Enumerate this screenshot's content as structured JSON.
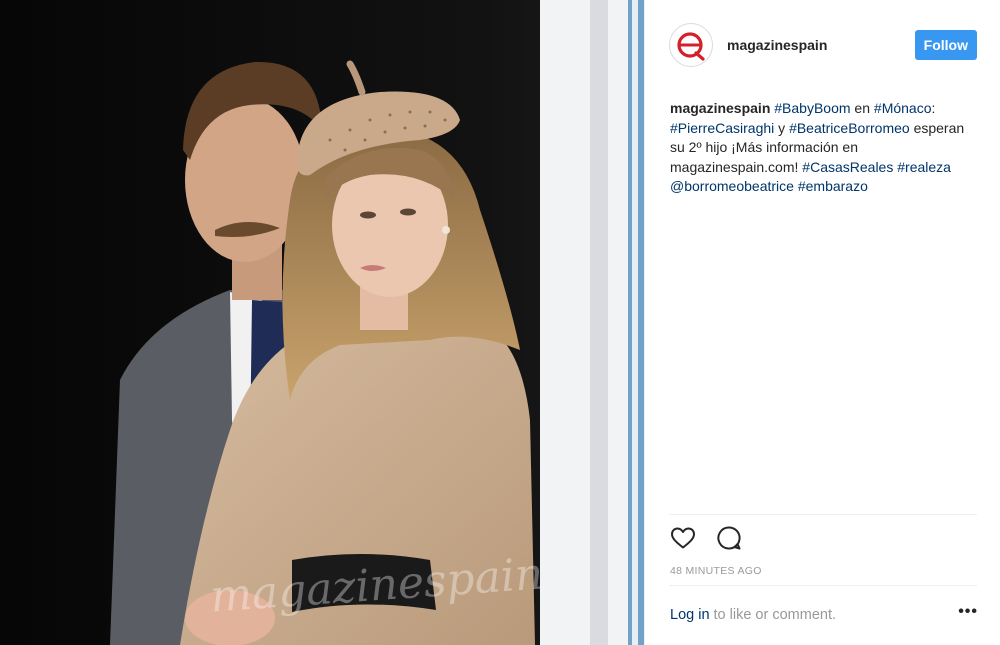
{
  "post": {
    "username": "magazinespain",
    "follow_label": "Follow",
    "caption": {
      "username": "magazinespain",
      "parts": [
        {
          "text": "#BabyBoom",
          "tag": true
        },
        {
          "text": " en ",
          "tag": false
        },
        {
          "text": "#Mónaco",
          "tag": true
        },
        {
          "text": ": ",
          "tag": false
        },
        {
          "text": "#PierreCasiraghi",
          "tag": true
        },
        {
          "text": " y ",
          "tag": false
        },
        {
          "text": "#BeatriceBorromeo",
          "tag": true
        },
        {
          "text": " esperan su 2º hijo ¡Más información en magazinespain.com! ",
          "tag": false
        },
        {
          "text": "#CasasReales",
          "tag": true
        },
        {
          "text": " ",
          "tag": false
        },
        {
          "text": "#realeza",
          "tag": true
        },
        {
          "text": " ",
          "tag": false
        },
        {
          "text": "@borromeobeatrice",
          "tag": true
        },
        {
          "text": " ",
          "tag": false
        },
        {
          "text": "#embarazo",
          "tag": true
        }
      ]
    },
    "timestamp": "48 minutes ago",
    "login_link": "Log in",
    "login_rest": "to like or comment.",
    "more_label": "•••",
    "watermark": "magazinespain",
    "icons": {
      "like": "heart-icon",
      "comment": "comment-icon",
      "more": "more-options-icon",
      "avatar": "magazinespain-logo"
    },
    "colors": {
      "follow": "#3897f0",
      "link": "#003569",
      "muted": "#999999",
      "brand_red": "#d4202a"
    }
  }
}
